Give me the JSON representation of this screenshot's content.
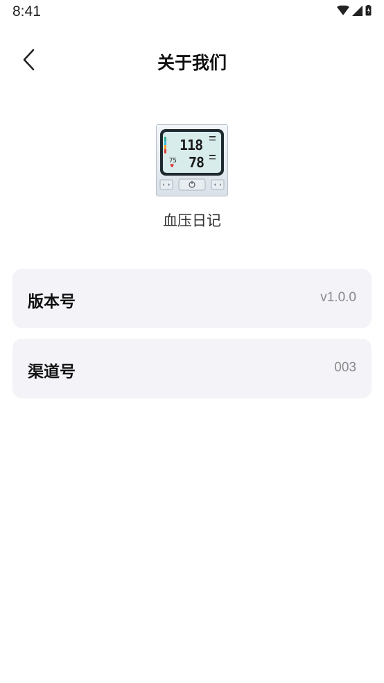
{
  "status_bar": {
    "time": "8:41",
    "icons": [
      "wifi-icon",
      "signal-icon",
      "battery-icon"
    ]
  },
  "header": {
    "title": "关于我们",
    "back_icon": "chevron-left-icon"
  },
  "app": {
    "name": "血压日记",
    "icon": "blood-pressure-monitor-icon",
    "icon_readout": {
      "systolic": "118",
      "diastolic": "78",
      "pulse": "75"
    }
  },
  "info": [
    {
      "label": "版本号",
      "value": "v1.0.0"
    },
    {
      "label": "渠道号",
      "value": "003"
    }
  ],
  "colors": {
    "background": "#ffffff",
    "card_background": "#f3f3f8",
    "value_text": "#8a8a8a",
    "lcd_screen": "#d8ecec"
  }
}
